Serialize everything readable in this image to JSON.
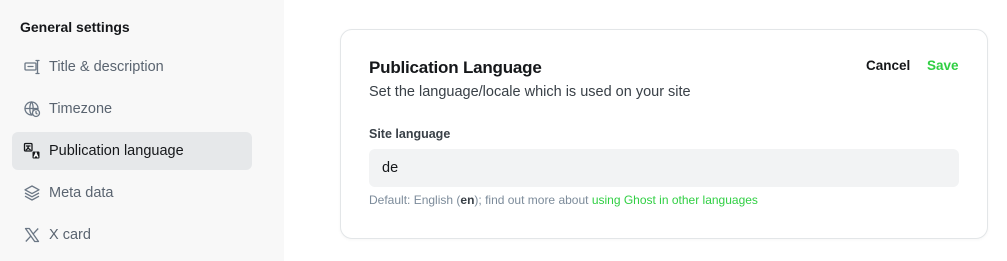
{
  "sidebar": {
    "heading": "General settings",
    "items": [
      {
        "label": "Title & description",
        "icon": "title-icon",
        "active": false
      },
      {
        "label": "Timezone",
        "icon": "globe-clock-icon",
        "active": false
      },
      {
        "label": "Publication language",
        "icon": "translate-icon",
        "active": true
      },
      {
        "label": "Meta data",
        "icon": "layers-icon",
        "active": false
      },
      {
        "label": "X card",
        "icon": "x-logo-icon",
        "active": false
      }
    ]
  },
  "card": {
    "title": "Publication Language",
    "subtitle": "Set the language/locale which is used on your site",
    "cancel_label": "Cancel",
    "save_label": "Save",
    "field_label": "Site language",
    "field_value": "de",
    "hint_prefix": "Default: English (",
    "hint_code": "en",
    "hint_middle": "); find out more about ",
    "hint_link": "using Ghost in other languages"
  },
  "colors": {
    "accent": "#30cf43",
    "active_bg": "#e6e8ea",
    "sidebar_bg": "#f8f8f8"
  }
}
